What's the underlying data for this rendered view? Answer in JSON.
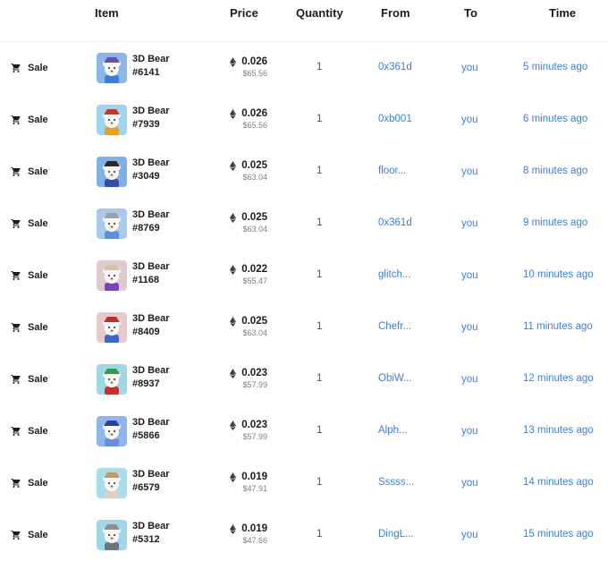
{
  "header": {
    "item": "Item",
    "price": "Price",
    "quantity": "Quantity",
    "from": "From",
    "to": "To",
    "time": "Time"
  },
  "colors": {
    "link": "#3b7fd6",
    "text": "#1c1c1c",
    "muted": "#7a7f87"
  },
  "rows": [
    {
      "event": "Sale",
      "name": "3D Bear",
      "number": "#6141",
      "price_eth": "0.026",
      "price_usd": "$65.56",
      "quantity": "1",
      "from": "0x361d",
      "to": "you",
      "time": "5 minutes ago",
      "thumb_bg": "#8ab6e8",
      "hat": "#6a4fb0",
      "shirt": "#3c7ed6"
    },
    {
      "event": "Sale",
      "name": "3D Bear",
      "number": "#7939",
      "price_eth": "0.026",
      "price_usd": "$65.56",
      "quantity": "1",
      "from": "0xb001",
      "to": "you",
      "time": "6 minutes ago",
      "thumb_bg": "#9fd3ee",
      "hat": "#c0392b",
      "shirt": "#e6a21e"
    },
    {
      "event": "Sale",
      "name": "3D Bear",
      "number": "#3049",
      "price_eth": "0.025",
      "price_usd": "$63.04",
      "quantity": "1",
      "from": "floor...",
      "to": "you",
      "time": "8 minutes ago",
      "thumb_bg": "#7fb0e6",
      "hat": "#2b2b2b",
      "shirt": "#2f4fa8"
    },
    {
      "event": "Sale",
      "name": "3D Bear",
      "number": "#8769",
      "price_eth": "0.025",
      "price_usd": "$63.04",
      "quantity": "1",
      "from": "0x361d",
      "to": "you",
      "time": "9 minutes ago",
      "thumb_bg": "#a8c8ee",
      "hat": "#9aa3ad",
      "shirt": "#5c8fd6"
    },
    {
      "event": "Sale",
      "name": "3D Bear",
      "number": "#1168",
      "price_eth": "0.022",
      "price_usd": "$55.47",
      "quantity": "1",
      "from": "glitch...",
      "to": "you",
      "time": "10 minutes ago",
      "thumb_bg": "#e2c8cf",
      "hat": "#d8c2a0",
      "shirt": "#7a43b8"
    },
    {
      "event": "Sale",
      "name": "3D Bear",
      "number": "#8409",
      "price_eth": "0.025",
      "price_usd": "$63.04",
      "quantity": "1",
      "from": "Chefr...",
      "to": "you",
      "time": "11 minutes ago",
      "thumb_bg": "#e6c9c9",
      "hat": "#b83232",
      "shirt": "#3c66c8"
    },
    {
      "event": "Sale",
      "name": "3D Bear",
      "number": "#8937",
      "price_eth": "0.023",
      "price_usd": "$57.99",
      "quantity": "1",
      "from": "ObiW...",
      "to": "you",
      "time": "12 minutes ago",
      "thumb_bg": "#9ed8e6",
      "hat": "#2e9b4a",
      "shirt": "#c23030"
    },
    {
      "event": "Sale",
      "name": "3D Bear",
      "number": "#5866",
      "price_eth": "0.023",
      "price_usd": "$57.99",
      "quantity": "1",
      "from": "Alph...",
      "to": "you",
      "time": "13 minutes ago",
      "thumb_bg": "#8fb6ea",
      "hat": "#2d3f9e",
      "shirt": "#6a8fd8"
    },
    {
      "event": "Sale",
      "name": "3D Bear",
      "number": "#6579",
      "price_eth": "0.019",
      "price_usd": "$47.91",
      "quantity": "1",
      "from": "Sssss...",
      "to": "you",
      "time": "14 minutes ago",
      "thumb_bg": "#a7dcec",
      "hat": "#c79a5a",
      "shirt": "#d8d2c4"
    },
    {
      "event": "Sale",
      "name": "3D Bear",
      "number": "#5312",
      "price_eth": "0.019",
      "price_usd": "$47.66",
      "quantity": "1",
      "from": "DingL...",
      "to": "you",
      "time": "15 minutes ago",
      "thumb_bg": "#9fd6e8",
      "hat": "#8a8f96",
      "shirt": "#6c7480"
    }
  ]
}
